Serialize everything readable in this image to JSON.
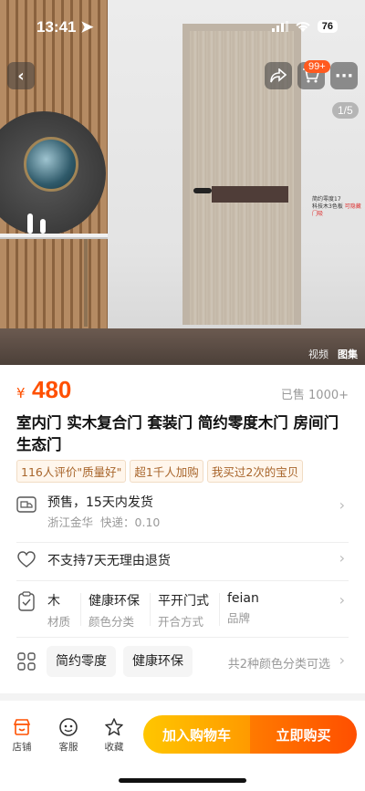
{
  "status": {
    "time": "13:41",
    "battery": "76"
  },
  "hero": {
    "cart_badge": "99+",
    "image_counter": "1/5",
    "caption_line1": "简约零度17",
    "caption_line2": "科技木3色板",
    "caption_line3": "可隐藏门吸",
    "media_tabs": [
      "视频",
      "图集"
    ]
  },
  "product": {
    "price_symbol": "¥",
    "price": "480",
    "sold": "已售 1000+",
    "title": "室内门 实木复合门 套装门 简约零度木门 房间门生态门",
    "tags": [
      "116人评价\"质量好\"",
      "超1千人加购",
      "我买过2次的宝贝"
    ]
  },
  "shipping": {
    "main": "预售，15天内发货",
    "location": "浙江金华",
    "fee": "快递：0.10"
  },
  "return_policy": "不支持7天无理由退货",
  "attributes": [
    {
      "value": "木",
      "key": "材质"
    },
    {
      "value": "健康环保",
      "key": "颜色分类"
    },
    {
      "value": "平开门式",
      "key": "开合方式"
    },
    {
      "value": "feian",
      "key": "品牌"
    }
  ],
  "color_options": {
    "chips": [
      "简约零度",
      "健康环保"
    ],
    "summary": "共2种颜色分类可选"
  },
  "bottom_bar": {
    "shop": "店铺",
    "service": "客服",
    "favorite": "收藏",
    "add_cart": "加入购物车",
    "buy_now": "立即购买"
  },
  "colors": {
    "accent": "#ff5000",
    "cart_button": "#ffb000",
    "buy_button": "#ff5a00"
  }
}
